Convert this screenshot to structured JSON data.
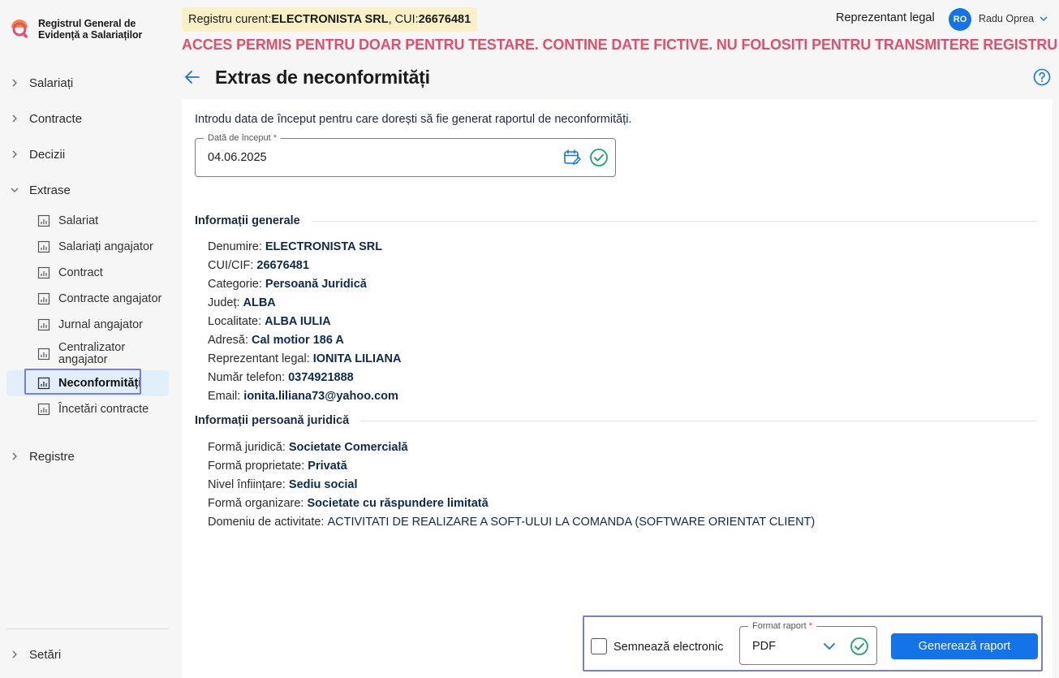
{
  "app": {
    "title_line1": "Registrul General de",
    "title_line2": "Evidență a Salariaților"
  },
  "sidebar": {
    "items": [
      {
        "label": "Salariați"
      },
      {
        "label": "Contracte"
      },
      {
        "label": "Decizii"
      },
      {
        "label": "Extrase"
      }
    ],
    "extrase_children": [
      {
        "label": "Salariat"
      },
      {
        "label": "Salariați angajator"
      },
      {
        "label": "Contract"
      },
      {
        "label": "Contracte angajator"
      },
      {
        "label": "Jurnal angajator"
      },
      {
        "label": "Centralizator angajator"
      },
      {
        "label": "Neconformități"
      },
      {
        "label": "Încetări contracte"
      }
    ],
    "registre": "Registre",
    "setari": "Setări"
  },
  "header": {
    "registry_prefix": "Registru curent: ",
    "registry_name": "ELECTRONISTA SRL",
    "cui_prefix": ", CUI: ",
    "cui": "26676481",
    "role": "Reprezentant legal",
    "avatar_initials": "RO",
    "user_name": "Radu Oprea",
    "warning": "ACCES PERMIS PENTRU DOAR PENTRU TESTARE. CONTINE DATE FICTIVE. NU FOLOSITI PENTRU TRANSMITERE REGISTRU"
  },
  "page": {
    "title": "Extras de neconformități",
    "intro": "Introdu data de început pentru care dorești să fie generat raportul de neconformități.",
    "date_label": "Dată de început",
    "required_mark": "*",
    "date_value": "04.06.2025"
  },
  "general_info": {
    "title": "Informații generale",
    "rows": [
      {
        "k": "Denumire:",
        "v": "ELECTRONISTA SRL"
      },
      {
        "k": "CUI/CIF:",
        "v": "26676481"
      },
      {
        "k": "Categorie:",
        "v": "Persoană Juridică"
      },
      {
        "k": "Județ:",
        "v": "ALBA"
      },
      {
        "k": "Localitate:",
        "v": "ALBA IULIA"
      },
      {
        "k": "Adresă:",
        "v": "Cal motior 186 A"
      },
      {
        "k": "Reprezentant legal:",
        "v": "IONITA LILIANA"
      },
      {
        "k": "Număr telefon:",
        "v": "0374921888"
      },
      {
        "k": "Email:",
        "v": "ionita.liliana73@yahoo.com"
      }
    ]
  },
  "legal_info": {
    "title": "Informații persoană juridică",
    "rows": [
      {
        "k": "Formă juridică:",
        "v": "Societate Comercială"
      },
      {
        "k": "Formă proprietate:",
        "v": "Privată"
      },
      {
        "k": "Nivel înființare:",
        "v": "Sediu social"
      },
      {
        "k": "Formă organizare:",
        "v": "Societate cu răspundere limitată"
      },
      {
        "k": "Domeniu de activitate:",
        "v": "ACTIVITATI DE REALIZARE A SOFT-ULUI LA COMANDA (SOFTWARE ORIENTAT CLIENT)"
      }
    ]
  },
  "footer": {
    "sign_label": "Semnează electronic",
    "format_label": "Format raport",
    "format_value": "PDF",
    "generate_label": "Generează raport"
  },
  "colors": {
    "accent": "#1473e6",
    "warning": "#e0506d",
    "success": "#1fa36b",
    "highlight_border": "#7b7dde",
    "registry_chip": "#faf0c8"
  }
}
